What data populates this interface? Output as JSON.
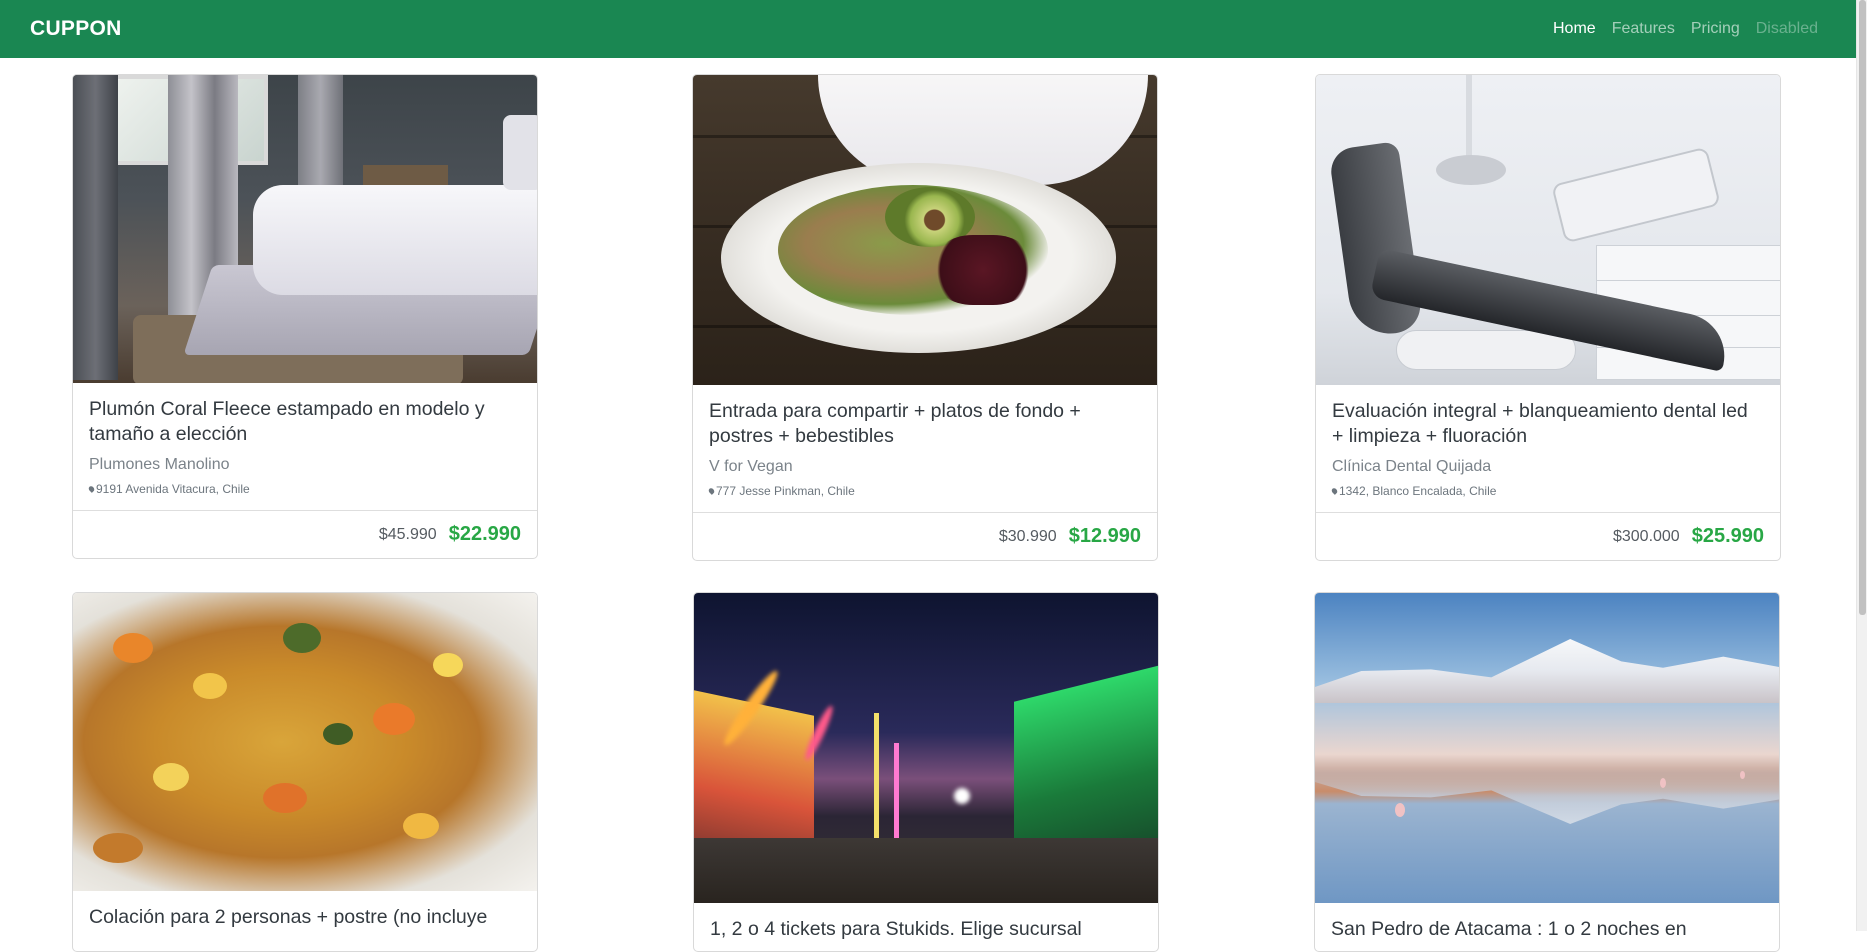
{
  "navbar": {
    "brand": "CUPPON",
    "links": [
      {
        "label": "Home",
        "state": "active"
      },
      {
        "label": "Features",
        "state": "normal"
      },
      {
        "label": "Pricing",
        "state": "normal"
      },
      {
        "label": "Disabled",
        "state": "disabled"
      }
    ]
  },
  "colors": {
    "navbar_bg": "#1a8752",
    "price_green": "#28a745",
    "card_border": "#d9d9d9"
  },
  "icons": {
    "location": "map-pin-icon"
  },
  "cards": [
    {
      "title": "Plumón Coral Fleece estampado en modelo y tamaño a elección",
      "merchant": "Plumones Manolino",
      "location": "9191 Avenida Vitacura, Chile",
      "old_price": "$45.990",
      "new_price": "$22.990",
      "image": "bedroom-photo"
    },
    {
      "title": "Entrada para compartir + platos de fondo + postres + bebestibles",
      "merchant": "V for Vegan",
      "location": "777 Jesse Pinkman, Chile",
      "old_price": "$30.990",
      "new_price": "$12.990",
      "image": "vegan-dish-photo"
    },
    {
      "title": "Evaluación integral + blanqueamiento dental led + limpieza + fluoración",
      "merchant": "Clínica Dental Quijada",
      "location": "1342, Blanco Encalada, Chile",
      "old_price": "$300.000",
      "new_price": "$25.990",
      "image": "dental-clinic-photo"
    },
    {
      "title": "Colación para 2 personas + postre (no incluye",
      "image": "stew-photo"
    },
    {
      "title": "1, 2 o 4 tickets para Stukids. Elige sucursal",
      "image": "night-fair-photo"
    },
    {
      "title": "San Pedro de Atacama : 1 o 2 noches en",
      "image": "salt-lake-photo"
    }
  ]
}
